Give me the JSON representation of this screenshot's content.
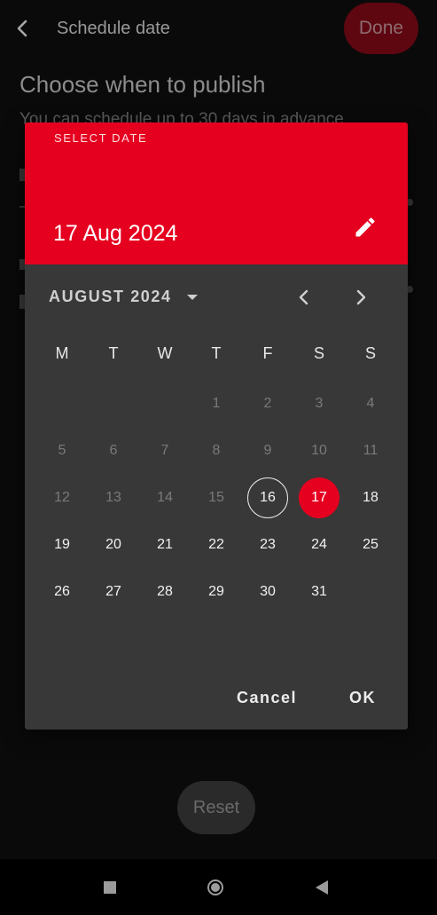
{
  "topbar": {
    "title": "Schedule date",
    "done_label": "Done"
  },
  "screen": {
    "heading": "Choose when to publish",
    "subtext": "You can schedule up to 30 days in advance",
    "reset_label": "Reset"
  },
  "dialog": {
    "select_label": "SELECT DATE",
    "selected_date": "17 Aug 2024",
    "month_label": "AUGUST 2024",
    "weekdays": [
      "M",
      "T",
      "W",
      "T",
      "F",
      "S",
      "S"
    ],
    "weeks": [
      [
        "",
        "",
        "",
        "1",
        "2",
        "3",
        "4"
      ],
      [
        "5",
        "6",
        "7",
        "8",
        "9",
        "10",
        "11"
      ],
      [
        "12",
        "13",
        "14",
        "15",
        "16",
        "17",
        "18"
      ],
      [
        "19",
        "20",
        "21",
        "22",
        "23",
        "24",
        "25"
      ],
      [
        "26",
        "27",
        "28",
        "29",
        "30",
        "31",
        ""
      ]
    ],
    "disabled_days": [
      "1",
      "2",
      "3",
      "4",
      "5",
      "6",
      "7",
      "8",
      "9",
      "10",
      "11",
      "12",
      "13",
      "14",
      "15"
    ],
    "today": "16",
    "selected": "17",
    "cancel_label": "Cancel",
    "ok_label": "OK"
  },
  "colors": {
    "accent": "#e5001f",
    "dialog_bg": "#383838",
    "background": "#0a0a0a"
  },
  "icons": {
    "back": "back-arrow-icon",
    "edit": "pencil-icon",
    "caret": "dropdown-caret-icon",
    "prev": "chevron-left-icon",
    "next": "chevron-right-icon",
    "nav_recent": "square-icon",
    "nav_home": "circle-icon",
    "nav_back": "triangle-icon"
  }
}
